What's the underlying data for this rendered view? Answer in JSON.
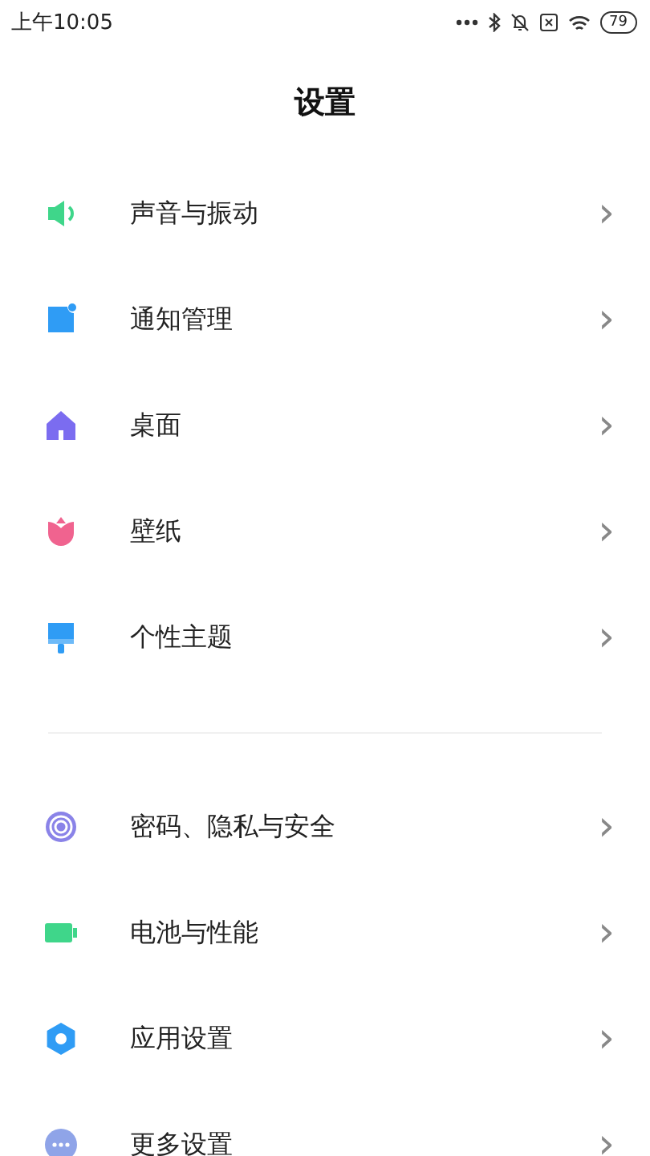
{
  "status_bar": {
    "time": "上午10:05",
    "battery": "79"
  },
  "title": "设置",
  "groups": [
    {
      "items": [
        {
          "label": "声音与振动",
          "kind": "speaker",
          "color": "#3fd68a",
          "chevron": "›"
        },
        {
          "label": "通知管理",
          "kind": "notification",
          "color": "#2f9cf5",
          "chevron": "›"
        },
        {
          "label": "桌面",
          "kind": "home",
          "color": "#7b6cf0",
          "chevron": "›"
        },
        {
          "label": "壁纸",
          "kind": "flower",
          "color": "#f0638f",
          "chevron": "›"
        },
        {
          "label": "个性主题",
          "kind": "brush",
          "color": "#2f9cf5",
          "chevron": "›"
        }
      ]
    },
    {
      "items": [
        {
          "label": "密码、隐私与安全",
          "kind": "fingerprint",
          "color": "#8a83e8",
          "chevron": "›"
        },
        {
          "label": "电池与性能",
          "kind": "battery",
          "color": "#3fd68a",
          "chevron": "›"
        },
        {
          "label": "应用设置",
          "kind": "gear",
          "color": "#2f9cf5",
          "chevron": "›"
        },
        {
          "label": "更多设置",
          "kind": "more",
          "color": "#8fa4e8",
          "chevron": "›"
        }
      ]
    }
  ]
}
